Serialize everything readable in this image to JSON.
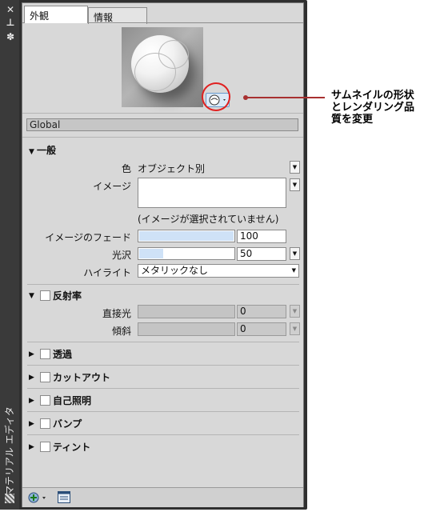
{
  "window": {
    "title": "マテリアル エディタ",
    "close_glyph": "✕",
    "pin_glyph": "⊥",
    "props_glyph": "✽"
  },
  "tabs": [
    {
      "label": "外観"
    },
    {
      "label": "情報"
    }
  ],
  "callout": {
    "line1": "サムネイルの形状",
    "line2": "とレンダリング品",
    "line3": "質を変更"
  },
  "material_name": "Global",
  "general": {
    "header": "一般",
    "color_label": "色",
    "color_value": "オブジェクト別",
    "image_label": "イメージ",
    "image_none": "(イメージが選択されていません)",
    "fade_label": "イメージのフェード",
    "fade_value": "100",
    "fade_fraction": 1.0,
    "gloss_label": "光沢",
    "gloss_value": "50",
    "gloss_fraction": 0.5,
    "highlight_label": "ハイライト",
    "highlight_value": "メタリックなし"
  },
  "reflectivity": {
    "header": "反射率",
    "direct_label": "直接光",
    "direct_value": "0",
    "oblique_label": "傾斜",
    "oblique_value": "0"
  },
  "sections": [
    {
      "label": "透過"
    },
    {
      "label": "カットアウト"
    },
    {
      "label": "自己照明"
    },
    {
      "label": "バンプ"
    },
    {
      "label": "ティント"
    }
  ],
  "colors": {
    "accent": "#cfe2f7",
    "callout": "#e02020"
  }
}
